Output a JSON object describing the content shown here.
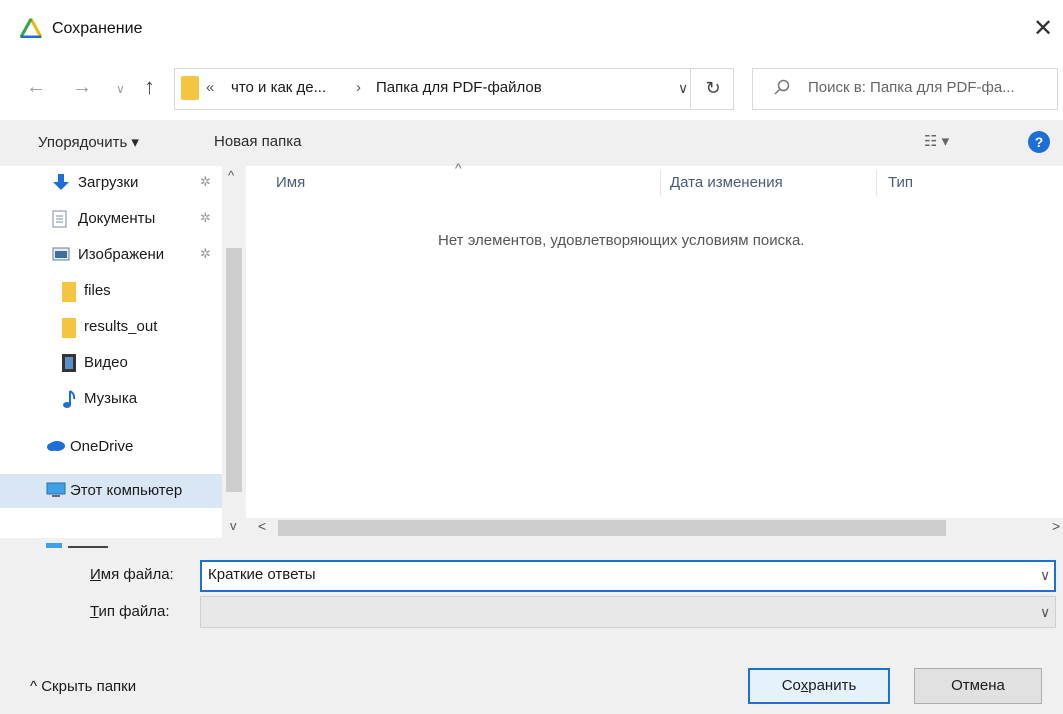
{
  "window": {
    "title": "Сохранение",
    "close_glyph": "✕"
  },
  "nav": {
    "back_glyph": "←",
    "forward_glyph": "→",
    "recent_glyph": "∨",
    "up_glyph": "↑",
    "address_prev": "«",
    "address_segments": [
      "что и как де...",
      "Папка для PDF-файлов"
    ],
    "address_separator": "›",
    "address_dropdown": "∨",
    "refresh_glyph": "↻",
    "search_placeholder": "Поиск в: Папка для PDF-фа..."
  },
  "toolbar": {
    "organize_label": "Упорядочить ▾",
    "new_folder_label": "Новая папка",
    "view_label": "☷ ▾",
    "help_label": "?"
  },
  "sidebar": {
    "items": [
      {
        "label": "Загрузки",
        "icon": "download-icon",
        "pinned": true
      },
      {
        "label": "Документы",
        "icon": "documents-icon",
        "pinned": true
      },
      {
        "label": "Изображени",
        "icon": "pictures-icon",
        "pinned": true
      },
      {
        "label": "files",
        "icon": "folder-icon",
        "pinned": false
      },
      {
        "label": "results_out",
        "icon": "folder-icon",
        "pinned": false
      },
      {
        "label": "Видео",
        "icon": "video-icon",
        "pinned": false
      },
      {
        "label": "Музыка",
        "icon": "music-icon",
        "pinned": false
      },
      {
        "label": "OneDrive",
        "icon": "cloud-icon",
        "pinned": false
      },
      {
        "label": "Этот компьютер",
        "icon": "computer-icon",
        "pinned": false
      }
    ],
    "pin_glyph": "✲"
  },
  "file_list": {
    "columns": [
      "Имя",
      "Дата изменения",
      "Тип"
    ],
    "empty_message": "Нет элементов, удовлетворяющих условиям поиска."
  },
  "form": {
    "filename_label_accel": "И",
    "filename_label_rest": "мя файла:",
    "filename_value": "Краткие ответы",
    "filetype_label_accel": "Т",
    "filetype_label_rest": "ип файла:",
    "filetype_value": ""
  },
  "footer": {
    "hide_folders_label": "^  Скрыть папки",
    "save_label_pre": "Со",
    "save_label_accel": "х",
    "save_label_post": "ранить",
    "cancel_label": "Отмена"
  },
  "colors": {
    "accent": "#1a73d1",
    "selected_bg": "#d9e7f5",
    "folder": "#f5c542",
    "help": "#1c6fd6"
  }
}
